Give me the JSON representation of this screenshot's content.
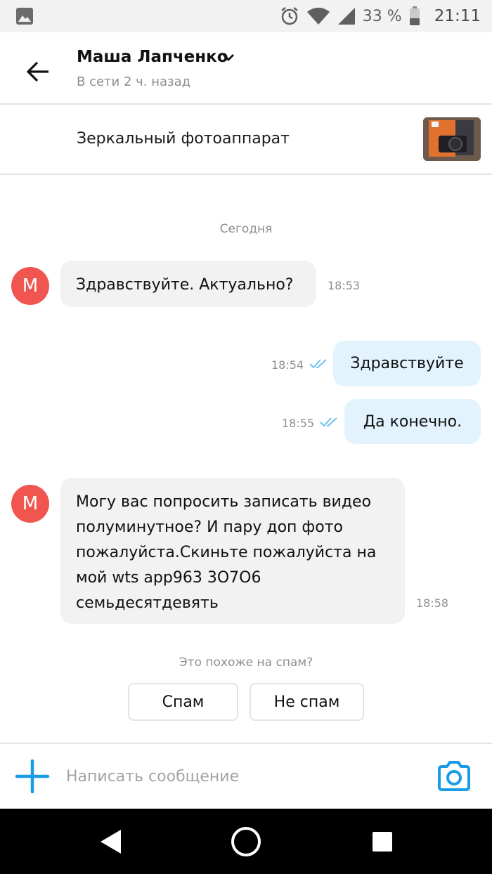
{
  "status_bar": {
    "battery": "33 %",
    "time": "21:11"
  },
  "header": {
    "contact_name": "Маша Лапченко",
    "contact_status": "В сети 2 ч. назад"
  },
  "listing": {
    "title": "Зеркальный фотоаппарат"
  },
  "chat": {
    "date_separator": "Сегодня",
    "messages": [
      {
        "direction": "in",
        "avatar_letter": "М",
        "text": "Здравствуйте. Актуально?",
        "time": "18:53"
      },
      {
        "direction": "out",
        "text": "Здравствуйте",
        "time": "18:54",
        "status": "read"
      },
      {
        "direction": "out",
        "text": "Да конечно.",
        "time": "18:55",
        "status": "read"
      },
      {
        "direction": "in",
        "avatar_letter": "М",
        "lines": [
          "Могу вас попросить записать видео",
          "полуминутное? И пару доп фото",
          "пожалуйста.Скиньте пожалуйста на",
          "мой wts app963 3О7О6",
          "семьдесятдевять"
        ],
        "time": "18:58"
      }
    ]
  },
  "spam": {
    "question": "Это похоже на спам?",
    "spam_label": "Спам",
    "not_spam_label": "Не спам"
  },
  "composer": {
    "placeholder": "Написать сообщение"
  },
  "colors": {
    "accent": "#1a9be6",
    "avatar": "#f0564f",
    "incoming_bubble": "#f2f2f2",
    "outgoing_bubble": "#e3f3fd"
  },
  "icons": [
    "gallery-icon",
    "alarm-icon",
    "wifi-icon",
    "signal-icon",
    "battery-icon",
    "back-arrow-icon",
    "chevron-down-icon",
    "read-ticks-icon",
    "plus-icon",
    "camera-icon",
    "nav-back-icon",
    "nav-home-icon",
    "nav-recents-icon"
  ]
}
